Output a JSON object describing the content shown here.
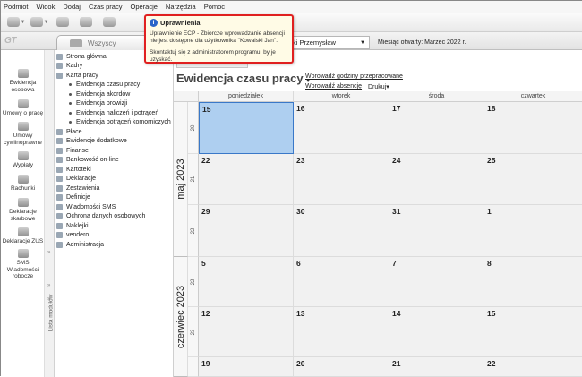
{
  "menu": [
    "Podmiot",
    "Widok",
    "Dodaj",
    "Czas pracy",
    "Operacje",
    "Narzędzia",
    "Pomoc"
  ],
  "toolbar_icons": [
    "printer-icon",
    "settings-icon",
    "money-icon",
    "refresh-icon",
    "help-icon"
  ],
  "tabs": {
    "all_label": "Wszyscy"
  },
  "company": {
    "value": "ki Przemysław"
  },
  "month_open": "Miesiąc otwarty: Marzec 2022 r.",
  "popup": {
    "title": "Uprawnienia",
    "line1": "Uprawnienie ECP - Zbiorcze wprowadzanie absencji",
    "line2": "nie jest dostępne dla użytkownika \"Kowalski Jan\".",
    "line3": "Skontaktuj się z administratorem programu, by je uzyskać."
  },
  "leftnav": [
    {
      "label": "Ewidencja osobowa",
      "icon": "people-icon"
    },
    {
      "label": "Umowy o pracę",
      "icon": "contract-icon"
    },
    {
      "label": "Umowy cywilnoprawne",
      "icon": "contract-icon"
    },
    {
      "label": "Wypłaty",
      "icon": "payout-icon"
    },
    {
      "label": "Rachunki",
      "icon": "bill-icon"
    },
    {
      "label": "Deklaracje skarbowe",
      "icon": "tax-icon"
    },
    {
      "label": "Deklaracje ZUS",
      "icon": "zus-icon"
    },
    {
      "label": "SMS Wiadomości robocze",
      "icon": "sms-icon"
    }
  ],
  "module_bar_label": "Lista modułów",
  "tree": [
    {
      "label": "Strona główna",
      "level": 0
    },
    {
      "label": "Kadry",
      "level": 0
    },
    {
      "label": "Karta pracy",
      "level": 0
    },
    {
      "label": "Ewidencja czasu pracy",
      "level": 1
    },
    {
      "label": "Ewidencja akordów",
      "level": 1
    },
    {
      "label": "Ewidencja prowizji",
      "level": 1
    },
    {
      "label": "Ewidencja naliczeń i potrąceń",
      "level": 1
    },
    {
      "label": "Ewidencja potrąceń komorniczych",
      "level": 1
    },
    {
      "label": "Płace",
      "level": 0
    },
    {
      "label": "Ewidencje dodatkowe",
      "level": 0
    },
    {
      "label": "Finanse",
      "level": 0
    },
    {
      "label": "Bankowość on-line",
      "level": 0
    },
    {
      "label": "Kartoteki",
      "level": 0
    },
    {
      "label": "Deklaracje",
      "level": 0
    },
    {
      "label": "Zestawienia",
      "level": 0
    },
    {
      "label": "Definicje",
      "level": 0
    },
    {
      "label": "Wiadomości SMS",
      "level": 0
    },
    {
      "label": "Ochrona danych osobowych",
      "level": 0
    },
    {
      "label": "Naklejki",
      "level": 0
    },
    {
      "label": "vendero",
      "level": 0
    },
    {
      "label": "Administracja",
      "level": 0
    }
  ],
  "calendar": {
    "title": "Ewidencja czasu pracy",
    "links": {
      "hours": "Wprowadź godziny przepracowane",
      "absence": "Wprowadź absencję",
      "print": "Drukuj"
    },
    "days": [
      "poniedziałek",
      "wtorek",
      "środa",
      "czwartek"
    ],
    "months": [
      "maj 2023",
      "czerwiec 2023"
    ],
    "weeks": [
      {
        "week": "20",
        "dates": [
          "15",
          "16",
          "17",
          "18"
        ]
      },
      {
        "week": "21",
        "dates": [
          "22",
          "23",
          "24",
          "25"
        ]
      },
      {
        "week": "22",
        "dates": [
          "29",
          "30",
          "31",
          "1"
        ]
      },
      {
        "week": "22",
        "dates": [
          "5",
          "6",
          "7",
          "8"
        ]
      },
      {
        "week": "23",
        "dates": [
          "12",
          "13",
          "14",
          "15"
        ]
      },
      {
        "week": "",
        "dates": [
          "19",
          "20",
          "21",
          "22"
        ]
      }
    ]
  }
}
